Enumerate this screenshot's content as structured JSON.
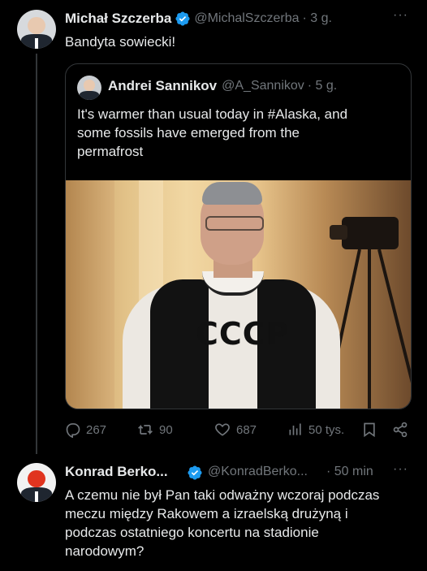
{
  "main_tweet": {
    "name": "Michał Szczerba",
    "handle": "@MichalSzczerba",
    "time": "· 3 g.",
    "text": "Bandyta sowiecki!",
    "more_icon": "more-horizontal-icon"
  },
  "quoted_tweet": {
    "name": "Andrei Sannikov",
    "handle": "@A_Sannikov",
    "time": "· 5 g.",
    "text_line1": "It's warmer than usual today in #Alaska, and",
    "text_line2": "some fossils have emerged from the",
    "text_line3": "permafrost",
    "photo_shirt_text": "CCCP"
  },
  "actions": {
    "replies": "267",
    "retweets": "90",
    "likes": "687",
    "views": "50 tys."
  },
  "reply_tweet": {
    "name": "Konrad Berko...",
    "handle": "@KonradBerko...",
    "time": "· 50 min",
    "line1": "A czemu nie był Pan taki odważny wczoraj podczas",
    "line2": "meczu między Rakowem a izraelską drużyną i",
    "line3": "podczas ostatniego koncertu na stadionie",
    "line4": "narodowym?"
  },
  "colors": {
    "background": "#000000",
    "text": "#e7e9ea",
    "muted": "#71767b",
    "verified": "#1d9bf0",
    "border": "#333639"
  }
}
